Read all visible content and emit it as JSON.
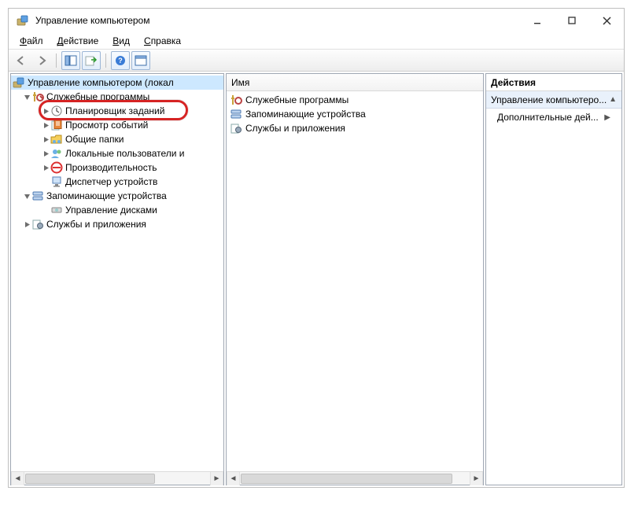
{
  "window": {
    "title": "Управление компьютером"
  },
  "menu": {
    "file": "Файл",
    "action": "Действие",
    "view": "Вид",
    "help": "Справка"
  },
  "toolbar_icons": {
    "back": "←",
    "forward": "→",
    "box1": "⧉",
    "refresh": "⟳",
    "help": "?",
    "box2": "⧉"
  },
  "tree": {
    "root": "Управление компьютером (локал",
    "group_tools": "Служебные программы",
    "tools": {
      "scheduler": "Планировщик заданий",
      "events": "Просмотр событий",
      "shares": "Общие папки",
      "users": "Локальные пользователи и",
      "perf": "Производительность",
      "devmgr": "Диспетчер устройств"
    },
    "group_storage": "Запоминающие устройства",
    "storage": {
      "diskmgmt": "Управление дисками"
    },
    "group_services": "Службы и приложения"
  },
  "list": {
    "header": "Имя",
    "rows": {
      "r1": "Служебные программы",
      "r2": "Запоминающие устройства",
      "r3": "Службы и приложения"
    }
  },
  "actions": {
    "header": "Действия",
    "section": "Управление компьютеро...",
    "more": "Дополнительные дей..."
  }
}
